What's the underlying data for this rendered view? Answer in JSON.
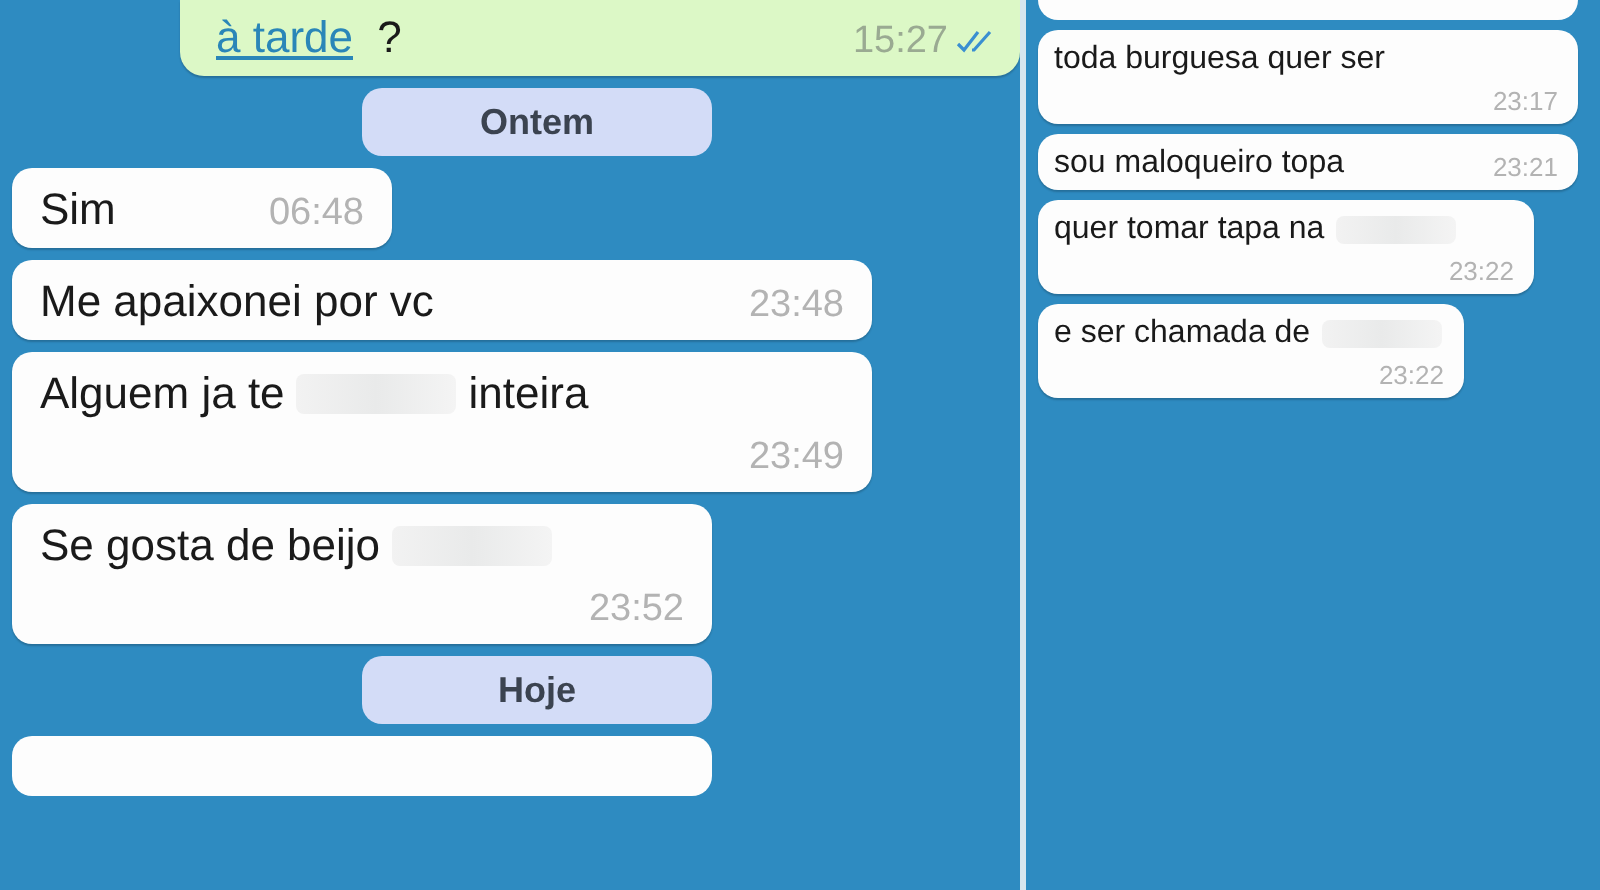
{
  "left_chat": {
    "messages": [
      {
        "kind": "outgoing",
        "parts": [
          {
            "kind": "link",
            "text": "à tarde"
          },
          {
            "kind": "plain",
            "text": " ?"
          }
        ],
        "time": "15:27",
        "read": true
      },
      {
        "kind": "date",
        "text": "Ontem"
      },
      {
        "kind": "inline",
        "parts": [
          {
            "kind": "plain",
            "text": "Sim"
          }
        ],
        "time": "06:48"
      },
      {
        "kind": "inline",
        "parts": [
          {
            "kind": "plain",
            "text": "Me apaixonei por vc"
          }
        ],
        "time": "23:48"
      },
      {
        "kind": "stacked",
        "parts": [
          {
            "kind": "plain",
            "text": "Alguem ja te"
          },
          {
            "kind": "redacted"
          },
          {
            "kind": "plain",
            "text": "inteira"
          }
        ],
        "time": "23:49"
      },
      {
        "kind": "stacked",
        "parts": [
          {
            "kind": "plain",
            "text": "Se gosta de beijo"
          },
          {
            "kind": "redacted"
          }
        ],
        "time": "23:52"
      },
      {
        "kind": "date",
        "text": "Hoje"
      },
      {
        "kind": "partial"
      }
    ]
  },
  "right_chat": {
    "messages": [
      {
        "kind": "partial"
      },
      {
        "kind": "stacked",
        "parts": [
          {
            "kind": "plain",
            "text": "toda burguesa quer ser"
          }
        ],
        "time": "23:17"
      },
      {
        "kind": "inline",
        "parts": [
          {
            "kind": "plain",
            "text": "sou maloqueiro topa"
          }
        ],
        "time": "23:21"
      },
      {
        "kind": "stacked",
        "parts": [
          {
            "kind": "plain",
            "text": "quer tomar tapa na"
          },
          {
            "kind": "redacted"
          }
        ],
        "time": "23:22"
      },
      {
        "kind": "stacked",
        "parts": [
          {
            "kind": "plain",
            "text": "e ser chamada de"
          },
          {
            "kind": "redacted"
          }
        ],
        "time": "23:22"
      }
    ]
  }
}
